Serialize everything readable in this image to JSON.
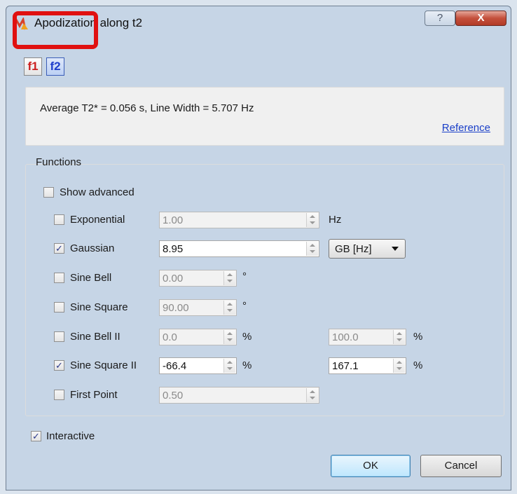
{
  "window": {
    "title": "Apodization along t2",
    "help_label": "?",
    "close_label": "X"
  },
  "dimension_tabs": {
    "f1": "f1",
    "f2": "f2"
  },
  "info": {
    "stats": "Average T2* = 0.056 s, Line Width = 5.707 Hz",
    "reference_link": "Reference"
  },
  "functions": {
    "group_title": "Functions",
    "show_advanced": {
      "label": "Show advanced",
      "checked": false
    },
    "rows": [
      {
        "label": "Exponential",
        "checked": false,
        "value": "1.00",
        "unit": "Hz"
      },
      {
        "label": "Gaussian",
        "checked": true,
        "value": "8.95",
        "dropdown": "GB [Hz]"
      },
      {
        "label": "Sine Bell",
        "checked": false,
        "value": "0.00",
        "unit": "°"
      },
      {
        "label": "Sine Square",
        "checked": false,
        "value": "90.00",
        "unit": "°"
      },
      {
        "label": "Sine Bell II",
        "checked": false,
        "value": "0.0",
        "unit": "%",
        "value2": "100.0",
        "unit2": "%"
      },
      {
        "label": "Sine Square II",
        "checked": true,
        "value": "-66.4",
        "unit": "%",
        "value2": "167.1",
        "unit2": "%"
      },
      {
        "label": "First Point",
        "checked": false,
        "value": "0.50"
      }
    ]
  },
  "interactive": {
    "label": "Interactive",
    "checked": true
  },
  "buttons": {
    "ok": "OK",
    "cancel": "Cancel"
  },
  "check_mark": "✓"
}
